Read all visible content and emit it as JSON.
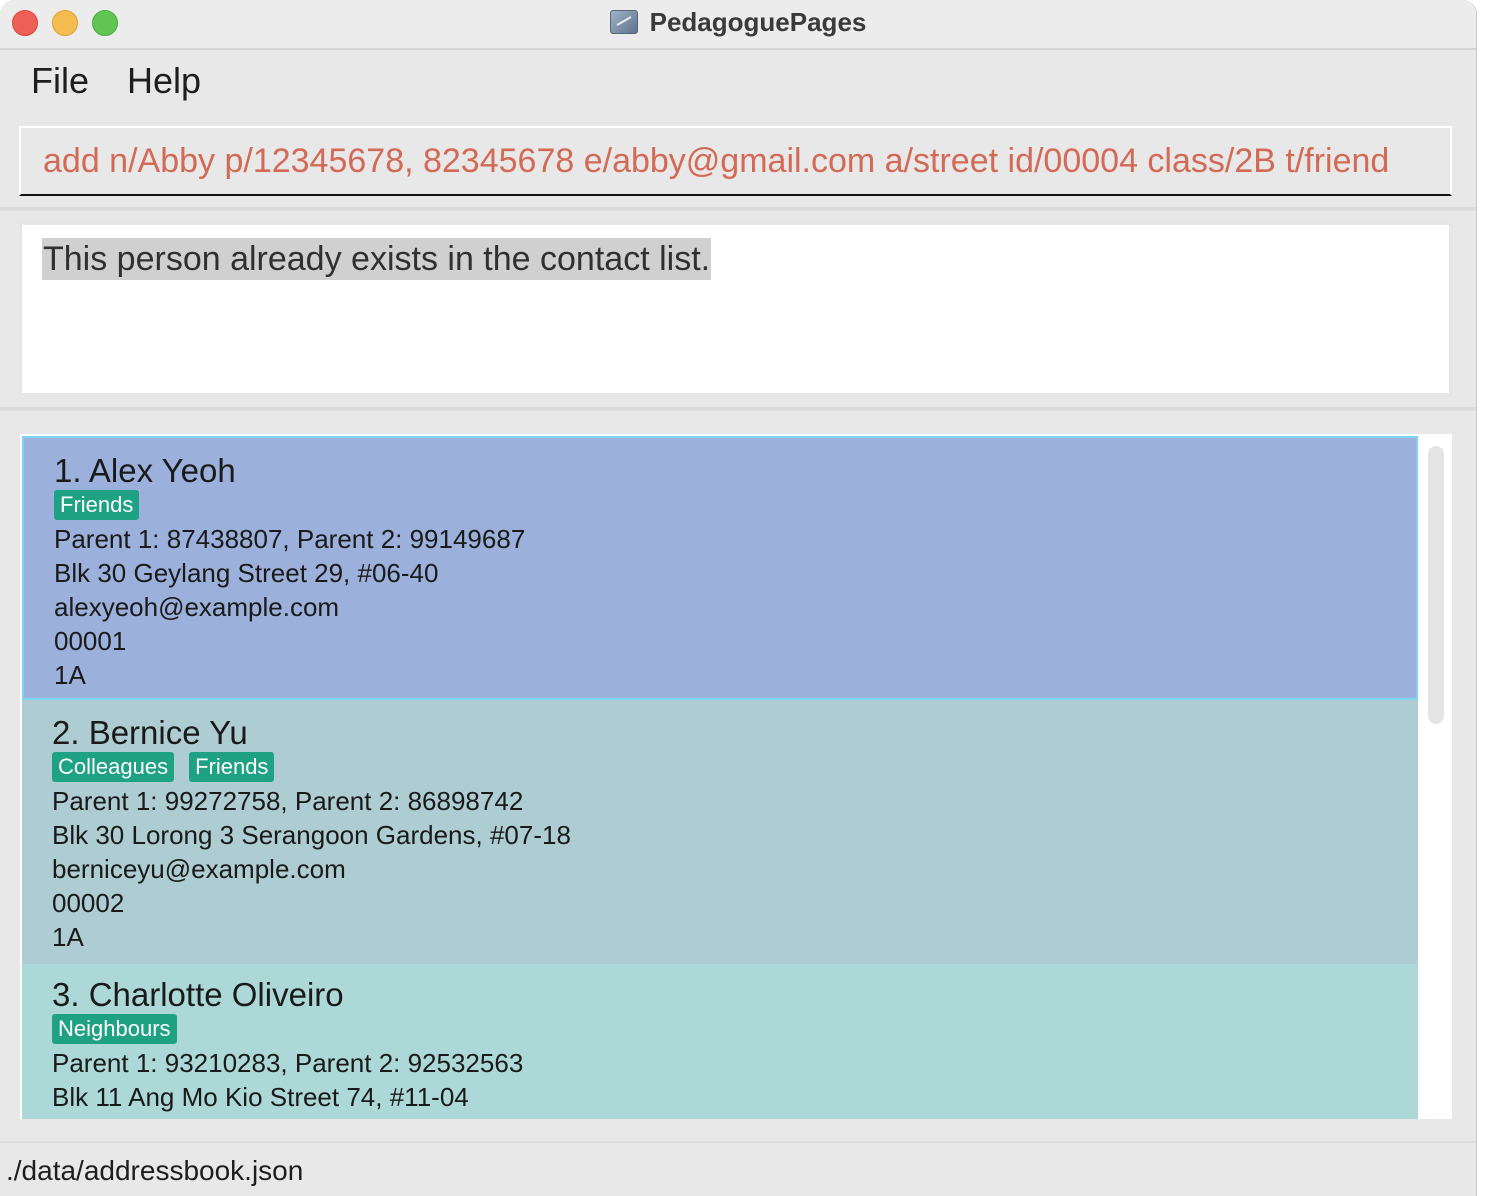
{
  "window": {
    "title": "PedagoguePages"
  },
  "menu": {
    "file": "File",
    "help": "Help"
  },
  "command": {
    "value": "add n/Abby p/12345678, 82345678 e/abby@gmail.com a/street id/00004 class/2B t/friend"
  },
  "result": {
    "message": "This person already exists in the contact list."
  },
  "contacts": [
    {
      "index_name": "1.  Alex Yeoh",
      "tags": [
        "Friends"
      ],
      "phones": "Parent 1: 87438807, Parent 2: 99149687",
      "address": "Blk 30 Geylang Street 29, #06-40",
      "email": "alexyeoh@example.com",
      "student_id": "00001",
      "class": "1A"
    },
    {
      "index_name": "2.  Bernice Yu",
      "tags": [
        "Colleagues",
        "Friends"
      ],
      "phones": "Parent 1: 99272758, Parent 2: 86898742",
      "address": "Blk 30 Lorong 3 Serangoon Gardens, #07-18",
      "email": "berniceyu@example.com",
      "student_id": "00002",
      "class": "1A"
    },
    {
      "index_name": "3.  Charlotte Oliveiro",
      "tags": [
        "Neighbours"
      ],
      "phones": "Parent 1: 93210283, Parent 2: 92532563",
      "address": "Blk 11 Ang Mo Kio Street 74, #11-04"
    }
  ],
  "status": {
    "file_path": "./data/addressbook.json"
  },
  "colors": {
    "selected_card": "#9bb0da",
    "card_even": "#aecdd2",
    "card_odd": "#acd8d7",
    "tag": "#1ea283",
    "command_text": "#d36a56"
  },
  "icons": {
    "app": "app-quill-icon"
  }
}
